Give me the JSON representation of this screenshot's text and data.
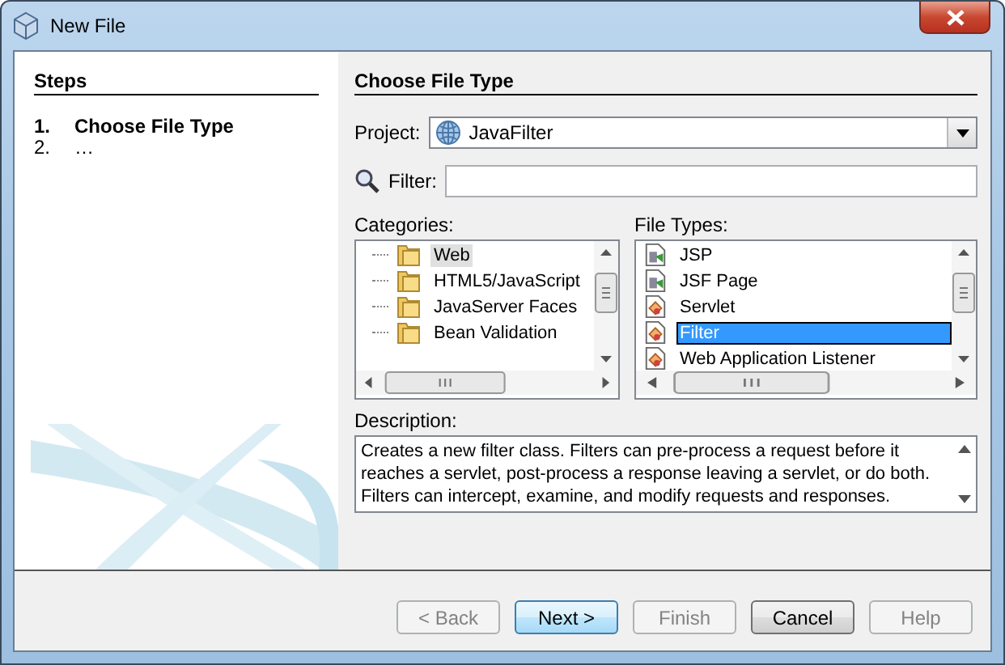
{
  "window": {
    "title": "New File"
  },
  "steps": {
    "title": "Steps",
    "items": [
      {
        "number": "1.",
        "label": "Choose File Type",
        "selected": true
      },
      {
        "number": "2.",
        "label": "…",
        "selected": false
      }
    ]
  },
  "panel": {
    "title": "Choose File Type",
    "project": {
      "label": "Project:",
      "value": "JavaFilter"
    },
    "filter": {
      "label": "Filter:"
    }
  },
  "categories": {
    "label": "Categories:",
    "items": [
      {
        "label": "Web",
        "selected": true
      },
      {
        "label": "HTML5/JavaScript",
        "selected": false
      },
      {
        "label": "JavaServer Faces",
        "selected": false
      },
      {
        "label": "Bean Validation",
        "selected": false
      }
    ]
  },
  "file_types": {
    "label": "File Types:",
    "items": [
      {
        "label": "JSP",
        "kind": "page",
        "selected": false
      },
      {
        "label": "JSF Page",
        "kind": "page",
        "selected": false
      },
      {
        "label": "Servlet",
        "kind": "class",
        "selected": false
      },
      {
        "label": "Filter",
        "kind": "class",
        "selected": true
      },
      {
        "label": "Web Application Listener",
        "kind": "class",
        "selected": false
      }
    ]
  },
  "description": {
    "label": "Description:",
    "text": "Creates a new filter class. Filters can pre-process a request before it reaches a servlet, post-process a response leaving a servlet, or do both. Filters can intercept, examine, and modify requests and responses."
  },
  "buttons": [
    {
      "label": "< Back",
      "disabled": true,
      "default": false
    },
    {
      "label": "Next >",
      "disabled": false,
      "default": true
    },
    {
      "label": "Finish",
      "disabled": true,
      "default": false
    },
    {
      "label": "Cancel",
      "disabled": false,
      "default": false
    },
    {
      "label": "Help",
      "disabled": true,
      "default": false
    }
  ]
}
